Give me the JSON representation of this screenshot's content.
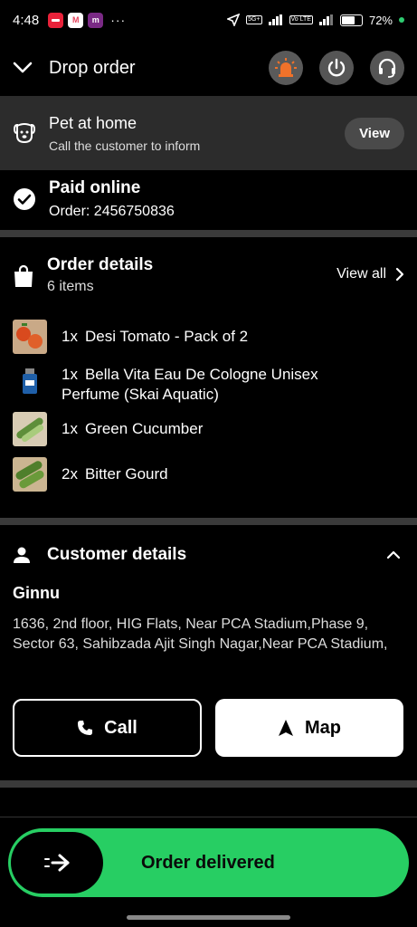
{
  "status_bar": {
    "time": "4:48",
    "dots": "···",
    "battery_percent": "72%",
    "battery_level": 0.72,
    "net_tag_1": "5G+",
    "net_tag_2": "Vo LTE"
  },
  "header": {
    "title": "Drop order"
  },
  "pet_banner": {
    "title": "Pet at home",
    "subtitle": "Call the customer to inform",
    "button": "View"
  },
  "payment": {
    "title": "Paid online",
    "order": "Order: 2456750836"
  },
  "order_details": {
    "title": "Order details",
    "count": "6 items",
    "view_all": "View all",
    "items": [
      {
        "qty": "1x",
        "name": "Desi Tomato - Pack of 2",
        "icon": "tomato-thumb"
      },
      {
        "qty": "1x",
        "name": "Bella Vita Eau De Cologne Unisex",
        "name2": "Perfume (Skai Aquatic)",
        "icon": "perfume-thumb"
      },
      {
        "qty": "1x",
        "name": "Green Cucumber",
        "icon": "cucumber-thumb"
      },
      {
        "qty": "2x",
        "name": "Bitter Gourd",
        "icon": "bitter-gourd-thumb"
      }
    ]
  },
  "customer": {
    "title": "Customer details",
    "name": "Ginnu",
    "address": "1636, 2nd floor, HIG Flats, Near PCA Stadium,Phase 9, Sector 63, Sahibzada Ajit Singh Nagar,Near PCA Stadium,",
    "call_label": "Call",
    "map_label": "Map"
  },
  "slider": {
    "label": "Order delivered"
  },
  "colors": {
    "accent_green": "#27ce63",
    "alert_orange": "#f0722a"
  }
}
